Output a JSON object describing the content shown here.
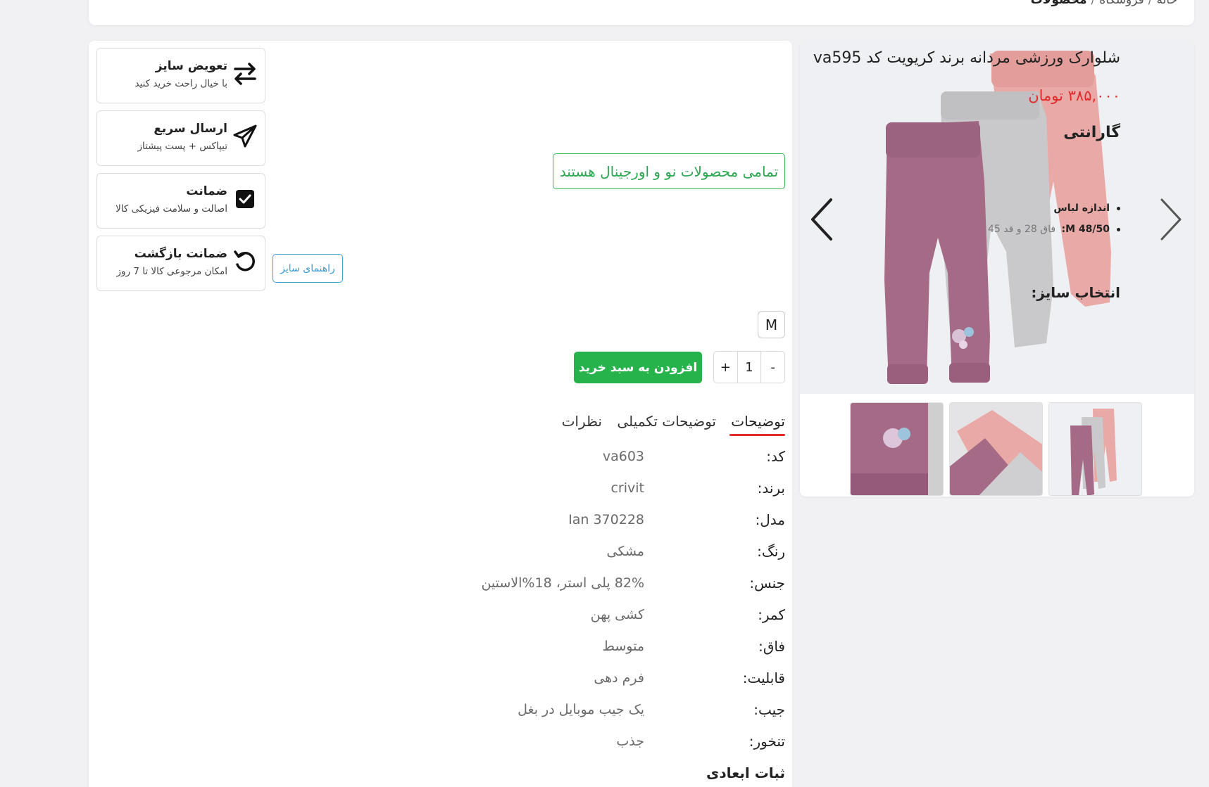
{
  "breadcrumb": {
    "home": "خانه",
    "shop": "فروشگاه",
    "current": "محصولات",
    "separator": "/"
  },
  "product": {
    "title": "شلوارک ورزشی مردانه برند کریویت کد va595",
    "price": "۳۸۵,۰۰۰ تومان",
    "warranty_heading": "گارانتی",
    "warranty_text": "تمامی محصولات نو و اورجینال هستند",
    "size_title": "اندازه لباس",
    "size_detail_label": "M 48/50:",
    "size_detail_value": "فاق 28 و قد 45",
    "size_select_heading": "انتخاب سایز:",
    "size_option": "M",
    "quantity": "1",
    "qty_plus": "+",
    "qty_minus": "-",
    "add_to_cart": "افزودن به سبد خرید",
    "size_guide": "راهنمای سایز"
  },
  "features": [
    {
      "title": "تعویض سایز",
      "subtitle": "با خیال راحت خرید کنید",
      "icon": "swap-arrows-icon"
    },
    {
      "title": "ارسال سریع",
      "subtitle": "تیپاکس + پست پیشتاز",
      "icon": "paper-plane-icon"
    },
    {
      "title": "ضمانت",
      "subtitle": "اصالت و سلامت فیزیکی کالا",
      "icon": "checkbox-icon"
    },
    {
      "title": "ضمانت بازگشت",
      "subtitle": "امکان مرجوعی کالا تا 7 روز",
      "icon": "undo-icon"
    }
  ],
  "tabs": [
    {
      "label": "توضیحات",
      "active": true
    },
    {
      "label": "توضیحات تکمیلی",
      "active": false
    },
    {
      "label": "نظرات",
      "active": false
    }
  ],
  "specs": [
    {
      "key": "کد:",
      "value": "va603"
    },
    {
      "key": "برند:",
      "value": "crivit"
    },
    {
      "key": "مدل:",
      "value": "Ian 370228"
    },
    {
      "key": "رنگ:",
      "value": "مشکی"
    },
    {
      "key": "جنس:",
      "value": "82% پلی استر، 18%الاستین"
    },
    {
      "key": "کمر:",
      "value": "کشی پهن"
    },
    {
      "key": "فاق:",
      "value": "متوسط"
    },
    {
      "key": "قابلیت:",
      "value": "فرم دهی"
    },
    {
      "key": "جیب:",
      "value": "یک جیب موبایل در بغل"
    },
    {
      "key": "تنخور:",
      "value": "جذب"
    },
    {
      "key": "ثبات ابعادی",
      "value": ""
    }
  ],
  "colors": {
    "accent_red": "#e02b2b",
    "green": "#27b34b",
    "blue": "#3a9bd6",
    "pants_mauve": "#a56b86",
    "pants_grey": "#c9c9cb",
    "pants_pink": "#e9a9a6"
  }
}
